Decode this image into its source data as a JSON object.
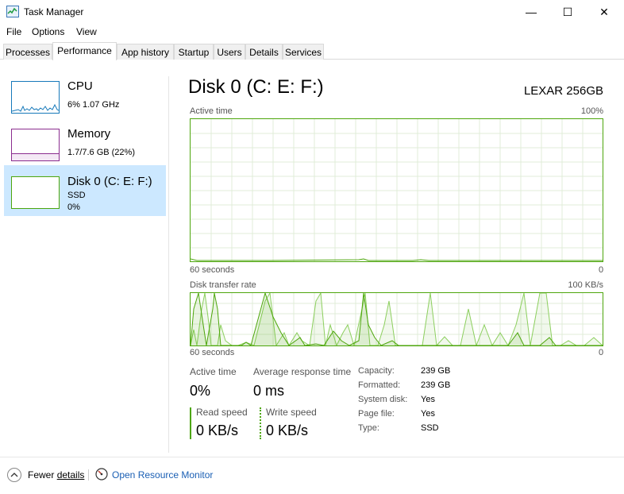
{
  "window": {
    "title": "Task Manager",
    "minimize_glyph": "—",
    "maximize_glyph": "☐",
    "close_glyph": "✕"
  },
  "menu": [
    "File",
    "Options",
    "View"
  ],
  "tabs": [
    "Processes",
    "Performance",
    "App history",
    "Startup",
    "Users",
    "Details",
    "Services"
  ],
  "active_tab": "Performance",
  "sidebar": {
    "items": [
      {
        "title": "CPU",
        "line1": "6%  1.07 GHz",
        "line2": "",
        "color": "#1779ba"
      },
      {
        "title": "Memory",
        "line1": "1.7/7.6 GB (22%)",
        "line2": "",
        "color": "#8b2d8f",
        "fill_fraction": 0.22
      },
      {
        "title": "Disk 0 (C: E: F:)",
        "line1": "SSD",
        "line2": "0%",
        "color": "#4da60c"
      }
    ],
    "selected_index": 2
  },
  "main": {
    "title": "Disk 0 (C: E: F:)",
    "model": "LEXAR 256GB",
    "active_time_graph": {
      "label": "Active time",
      "max_label": "100%",
      "x_left_label": "60 seconds",
      "x_right_label": "0"
    },
    "transfer_graph": {
      "label": "Disk transfer rate",
      "max_label": "100 KB/s",
      "x_left_label": "60 seconds",
      "x_right_label": "0"
    },
    "stats": {
      "active_time_label": "Active time",
      "active_time_value": "0%",
      "avg_response_label": "Average response time",
      "avg_response_value": "0 ms",
      "read_label": "Read speed",
      "read_value": "0 KB/s",
      "write_label": "Write speed",
      "write_value": "0 KB/s"
    },
    "details": [
      {
        "key": "Capacity:",
        "value": "239 GB"
      },
      {
        "key": "Formatted:",
        "value": "239 GB"
      },
      {
        "key": "System disk:",
        "value": "Yes"
      },
      {
        "key": "Page file:",
        "value": "Yes"
      },
      {
        "key": "Type:",
        "value": "SSD"
      }
    ]
  },
  "footer": {
    "fewer_details_prefix": "Fewer ",
    "fewer_details_underlined": "details",
    "open_resource_monitor": "Open Resource Monitor"
  },
  "colors": {
    "disk_green": "#4da60c",
    "selected_bg": "#cce8ff",
    "link_blue": "#1a5fb4"
  }
}
